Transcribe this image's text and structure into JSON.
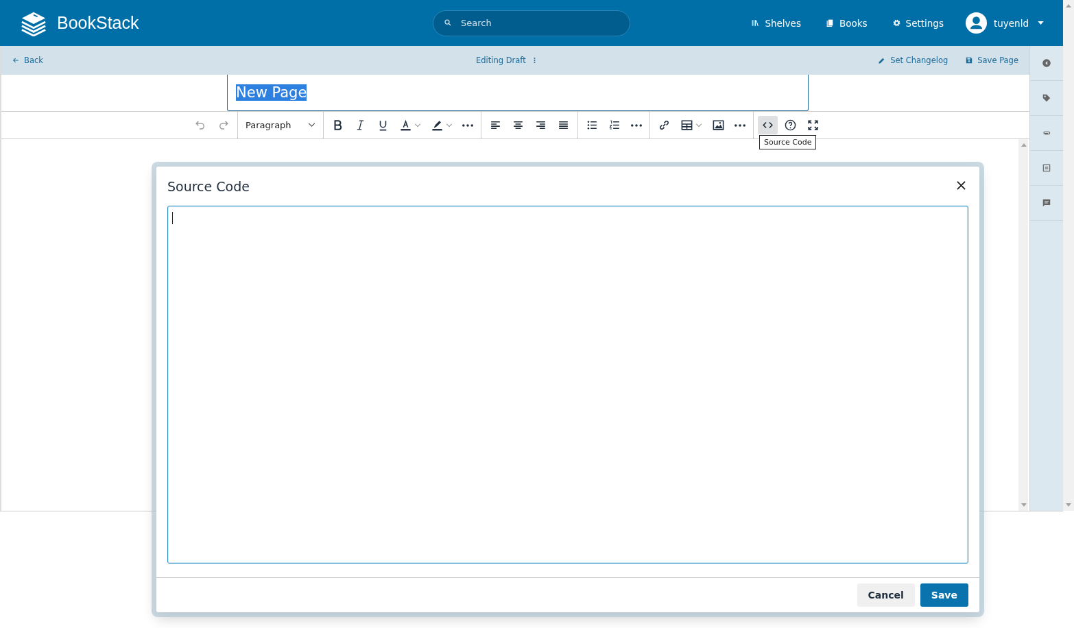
{
  "header": {
    "brand": "BookStack",
    "search": {
      "placeholder": "Search"
    },
    "nav": [
      {
        "kind": "shelves",
        "label": "Shelves"
      },
      {
        "kind": "books",
        "label": "Books"
      },
      {
        "kind": "settings",
        "label": "Settings"
      }
    ],
    "user": {
      "name": "tuyenld"
    }
  },
  "action_bar": {
    "back": "Back",
    "status": "Editing Draft",
    "changelog": "Set Changelog",
    "save": "Save Page"
  },
  "title_field": {
    "value": "New Page",
    "text_selected": true
  },
  "toolbar": {
    "format_select": "Paragraph",
    "groups": [
      [
        {
          "kind": "undo",
          "disabled": true,
          "dropdown": false,
          "highlighted": false
        },
        {
          "kind": "redo",
          "disabled": true,
          "dropdown": false,
          "highlighted": false
        }
      ],
      [
        {
          "kind": "format"
        }
      ],
      [
        {
          "kind": "bold",
          "disabled": false,
          "dropdown": false,
          "highlighted": false
        },
        {
          "kind": "italic",
          "disabled": false,
          "dropdown": false,
          "highlighted": false
        },
        {
          "kind": "underline",
          "disabled": false,
          "dropdown": false,
          "highlighted": false
        },
        {
          "kind": "text-color",
          "disabled": false,
          "dropdown": true,
          "highlighted": false
        },
        {
          "kind": "highlight",
          "disabled": false,
          "dropdown": true,
          "highlighted": false
        },
        {
          "kind": "more",
          "disabled": false,
          "dropdown": false,
          "highlighted": false
        }
      ],
      [
        {
          "kind": "align-left",
          "disabled": false,
          "dropdown": false,
          "highlighted": false
        },
        {
          "kind": "align-center",
          "disabled": false,
          "dropdown": false,
          "highlighted": false
        },
        {
          "kind": "align-right",
          "disabled": false,
          "dropdown": false,
          "highlighted": false
        },
        {
          "kind": "justify",
          "disabled": false,
          "dropdown": false,
          "highlighted": false
        }
      ],
      [
        {
          "kind": "bullet-list",
          "disabled": false,
          "dropdown": false,
          "highlighted": false
        },
        {
          "kind": "numbered-list",
          "disabled": false,
          "dropdown": false,
          "highlighted": false
        },
        {
          "kind": "more",
          "disabled": false,
          "dropdown": false,
          "highlighted": false
        }
      ],
      [
        {
          "kind": "link",
          "disabled": false,
          "dropdown": false,
          "highlighted": false
        },
        {
          "kind": "table",
          "disabled": false,
          "dropdown": true,
          "highlighted": false
        },
        {
          "kind": "image",
          "disabled": false,
          "dropdown": false,
          "highlighted": false
        },
        {
          "kind": "more",
          "disabled": false,
          "dropdown": false,
          "highlighted": false
        }
      ],
      [
        {
          "kind": "code",
          "disabled": false,
          "dropdown": false,
          "highlighted": true
        },
        {
          "kind": "help",
          "disabled": false,
          "dropdown": false,
          "highlighted": false
        },
        {
          "kind": "fullscreen",
          "disabled": false,
          "dropdown": false,
          "highlighted": false
        }
      ]
    ],
    "tooltip": "Source Code"
  },
  "sidebar": [
    {
      "kind": "collapse"
    },
    {
      "kind": "tag"
    },
    {
      "kind": "attachment"
    },
    {
      "kind": "template"
    },
    {
      "kind": "comment"
    }
  ],
  "dialog": {
    "title": "Source Code",
    "buttons": [
      {
        "kind": "secondary",
        "label": "Cancel"
      },
      {
        "kind": "primary",
        "label": "Save"
      }
    ]
  }
}
